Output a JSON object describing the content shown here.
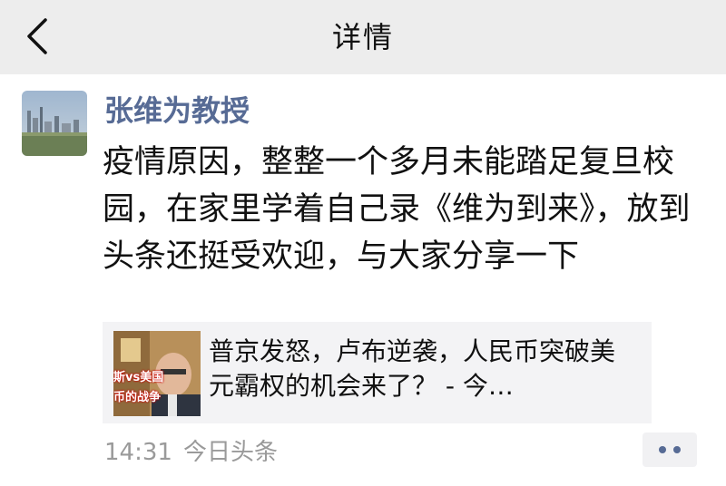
{
  "header": {
    "title": "详情",
    "back_icon": "chevron-left-icon"
  },
  "post": {
    "author": "张维为教授",
    "text": "疫情原因，整整一个多月未能踏足复旦校园，在家里学着自己录《维为到来》，放到头条还挺受欢迎，与大家分享一下",
    "shared_link": {
      "thumbnail_text_top": "斯vs美国",
      "thumbnail_text_bottom": "币的战争",
      "title": "普京发怒，卢布逆袭，人民币突破美元霸权的机会来了？ - 今…"
    },
    "time": "14:31",
    "source": "今日头条",
    "more_icon": "more-dots-icon"
  },
  "colors": {
    "topbar_bg": "#ededed",
    "author_link": "#576b95",
    "meta_gray": "#9a9a9a",
    "card_bg": "#f3f3f5"
  }
}
